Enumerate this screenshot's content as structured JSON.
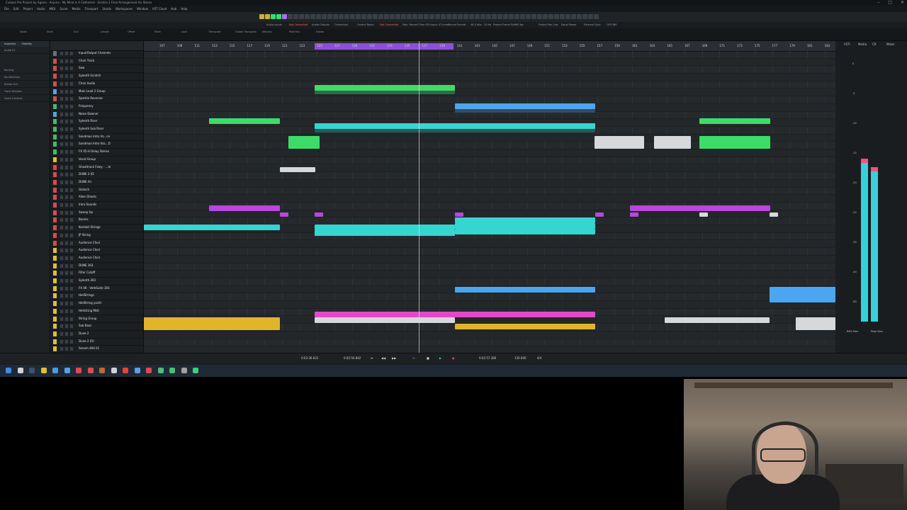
{
  "window": {
    "title": "Cubase Pro Project by Agoria - Anjuna - My Mind Is A Cathedral - Sindria 2 Final Arrangement for Stems"
  },
  "menu": [
    "File",
    "Edit",
    "Project",
    "Audio",
    "MIDI",
    "Score",
    "Media",
    "Transport",
    "Studio",
    "Workspaces",
    "Window",
    "VST Cloud",
    "Hub",
    "Help"
  ],
  "statusline": [
    "Audio Inputs",
    "Not Connected",
    "Audio Outputs",
    "Connected",
    "Control Room",
    "Not Connected",
    "Max. Record Time",
    "439 hours 47 mins",
    "Record Format",
    "48.0 kHz - 24 bit",
    "Project Frame Rate",
    "30 fps",
    "Project Pan Law",
    "Equal Power",
    "External Sync",
    "OFFLINE"
  ],
  "infoline": [
    "Name",
    "Start",
    "End",
    "Length",
    "Offset",
    "Mute",
    "Lock",
    "Transpose",
    "Global Transpose",
    "Velocity",
    "Root Key",
    "Follow"
  ],
  "inspector": {
    "tabs": [
      "Inspector",
      "Visibility"
    ],
    "items": [
      "Audio 01",
      "Routing",
      "No Selection",
      "Stereo Out",
      "Track Versions",
      "Quick Controls"
    ]
  },
  "tracks": [
    {
      "name": "Input/Output Channels",
      "color": "#6a6f74"
    },
    {
      "name": "Choir Track",
      "color": "#d94a4a"
    },
    {
      "name": "Saw",
      "color": "#d94a4a"
    },
    {
      "name": "Sylenth Scratch",
      "color": "#d94a4a"
    },
    {
      "name": "Choir Audio",
      "color": "#d94a4a"
    },
    {
      "name": "Main Lead 2 Group",
      "color": "#5aa0e0"
    },
    {
      "name": "Sparkle Reverser",
      "color": "#d94a4a",
      "sub": "Velocity"
    },
    {
      "name": "Frequency",
      "color": "#38c06a"
    },
    {
      "name": "Noise Downer",
      "color": "#5aa0e0",
      "sub": "Filter/LFO Cutoff"
    },
    {
      "name": "Sylenth Riser",
      "color": "#38c06a"
    },
    {
      "name": "Sylenth Sub Riser",
      "color": "#38c06a",
      "sub": "Frequency"
    },
    {
      "name": "Sandman Intro Vo...ce",
      "color": "#38c06a"
    },
    {
      "name": "Sandman Intro Voc...D",
      "color": "#38c06a"
    },
    {
      "name": "FX 05-H Delay Stereo",
      "color": "#38c06a",
      "sub": "Volume"
    },
    {
      "name": "Vocal Group",
      "color": "#e0c030"
    },
    {
      "name": "Ghosttrack Foley - ...le",
      "color": "#d94a4a"
    },
    {
      "name": "DUNE 3 02",
      "color": "#d94a4a"
    },
    {
      "name": "DUNE Air",
      "color": "#d94a4a"
    },
    {
      "name": "Glotsch",
      "color": "#d94a4a"
    },
    {
      "name": "Alien Ghosts",
      "color": "#d94a4a"
    },
    {
      "name": "Intro Sounds",
      "color": "#d94a4a"
    },
    {
      "name": "Sweep Up",
      "color": "#d94a4a"
    },
    {
      "name": "Booms",
      "color": "#d94a4a"
    },
    {
      "name": "Kontakt Strings",
      "color": "#d94a4a"
    },
    {
      "name": "JP String",
      "color": "#d94a4a"
    },
    {
      "name": "Audience Choir",
      "color": "#d94a4a",
      "sub": "Volume"
    },
    {
      "name": "Audience Choir",
      "color": "#e0c030"
    },
    {
      "name": "Audience Choir",
      "color": "#e0c030"
    },
    {
      "name": "DUNE 303",
      "color": "#e0c030",
      "sub": "Volume"
    },
    {
      "name": "Filter Cutoff",
      "color": "#e0c030"
    },
    {
      "name": "Sylenth 303",
      "color": "#e0c030"
    },
    {
      "name": "FX 06 - VerbSuite 303",
      "color": "#e0c030",
      "sub": "Dry/Wet"
    },
    {
      "name": "HellStrings",
      "color": "#e0c030"
    },
    {
      "name": "HellString yacht",
      "color": "#e0c030"
    },
    {
      "name": "Hellstring Midi",
      "color": "#e0c030"
    },
    {
      "name": "String Group",
      "color": "#e0c030"
    },
    {
      "name": "Sub Bass",
      "color": "#e0c030"
    },
    {
      "name": "Dune 2",
      "color": "#e0c030"
    },
    {
      "name": "Dune 2 (D)",
      "color": "#e0c030"
    },
    {
      "name": "Sonom 464 01",
      "color": "#e0c030"
    }
  ],
  "ruler": {
    "bars": [
      "107",
      "109",
      "111",
      "113",
      "115",
      "117",
      "119",
      "121",
      "123",
      "125",
      "127",
      "129",
      "131",
      "133",
      "135",
      "137",
      "139",
      "141",
      "143",
      "145",
      "147",
      "149",
      "151",
      "153",
      "155",
      "157",
      "159",
      "161",
      "163",
      "165",
      "167",
      "169",
      "171",
      "173",
      "175",
      "177",
      "179",
      "181",
      "183"
    ]
  },
  "transport": {
    "left_time": "0:02:36.631",
    "right_time": "0:02:56.842",
    "position": "0:02:57.380",
    "tempo": "130.000",
    "signature": "4/4"
  },
  "meter": {
    "tabs": [
      "VSTi",
      "Media",
      "CR",
      "Meter"
    ],
    "labels": [
      "RMS Max.",
      "Peak Max."
    ],
    "db": [
      "0",
      "-5",
      "-10",
      "-15",
      "-20",
      "-25",
      "-30",
      "-40",
      "-60"
    ]
  },
  "colors": {
    "green": "#3ddc6a",
    "blue": "#4aa6f0",
    "cyan": "#35d6cf",
    "purple": "#b54ad8",
    "yellow": "#e2b42a",
    "white": "#d6d8da",
    "pink": "#e04ac8"
  }
}
